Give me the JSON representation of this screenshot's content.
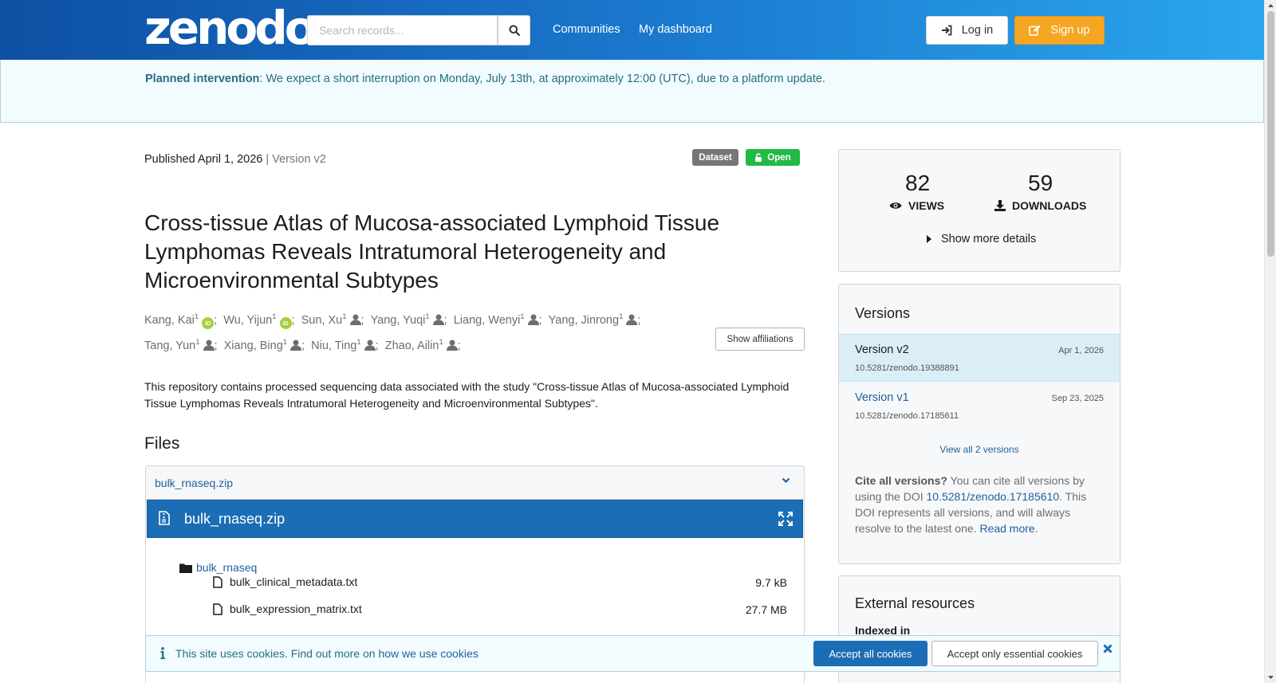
{
  "header": {
    "logo": "zenodo",
    "search_placeholder": "Search records...",
    "nav": [
      "Communities",
      "My dashboard"
    ],
    "login_label": "Log in",
    "signup_label": "Sign up"
  },
  "banner": {
    "label": "Planned intervention",
    "text": ": We expect a short interruption on Monday, July 13th, at approximately 12:00 (UTC), due to a platform update."
  },
  "record": {
    "published": "Published April 1, 2026",
    "separator": " | ",
    "version": "Version v2",
    "badge_type": "Dataset",
    "badge_access": "Open",
    "title": "Cross-tissue Atlas of Mucosa-associated Lymphoid Tissue Lymphomas Reveals Intratumoral Heterogeneity and Microenvironmental Subtypes",
    "creators": [
      {
        "name": "Kang, Kai",
        "aff": "1",
        "icon": "orcid"
      },
      {
        "name": "Wu, Yijun",
        "aff": "1",
        "icon": "orcid"
      },
      {
        "name": "Sun, Xu",
        "aff": "1",
        "icon": "person"
      },
      {
        "name": "Yang, Yuqi",
        "aff": "1",
        "icon": "person"
      },
      {
        "name": "Liang, Wenyi",
        "aff": "1",
        "icon": "person"
      },
      {
        "name": "Yang, Jinrong",
        "aff": "1",
        "icon": "person"
      },
      {
        "name": "Tang, Yun",
        "aff": "1",
        "icon": "person"
      },
      {
        "name": "Xiang, Bing",
        "aff": "1",
        "icon": "person"
      },
      {
        "name": "Niu, Ting",
        "aff": "1",
        "icon": "person"
      },
      {
        "name": "Zhao, Ailin",
        "aff": "1",
        "icon": "person"
      }
    ],
    "show_affiliations": "Show affiliations",
    "description": "This repository contains processed sequencing data associated with the study \"Cross-tissue Atlas of Mucosa-associated Lymphoid Tissue Lymphomas Reveals Intratumoral Heterogeneity and Microenvironmental Subtypes\".",
    "files_heading": "Files",
    "file_accordion": "bulk_rnaseq.zip",
    "preview_name": "bulk_rnaseq.zip",
    "tree_folder": "bulk_rnaseq",
    "tree_files": [
      {
        "name": "bulk_clinical_metadata.txt",
        "size": "9.7 kB"
      },
      {
        "name": "bulk_expression_matrix.txt",
        "size": "27.7 MB"
      }
    ]
  },
  "sidebar": {
    "views_count": "82",
    "views_label": "VIEWS",
    "downloads_count": "59",
    "downloads_label": "DOWNLOADS",
    "show_more": "Show more details",
    "versions_title": "Versions",
    "versions": [
      {
        "name": "Version v2",
        "doi": "10.5281/zenodo.19388891",
        "date": "Apr 1, 2026"
      },
      {
        "name": "Version v1",
        "doi": "10.5281/zenodo.17185611",
        "date": "Sep 23, 2025"
      }
    ],
    "view_all": "View all 2 versions",
    "cite_bold": "Cite all versions?",
    "cite_text1": " You can cite all versions by using the DOI ",
    "cite_doi": "10.5281/zenodo.17185610",
    "cite_text2": ". This DOI represents all versions, and will always resolve to the latest one. ",
    "cite_read_more": "Read more",
    "cite_end": ".",
    "external_title": "External resources",
    "indexed_in": "Indexed in"
  },
  "cookie": {
    "text": "This site uses cookies. Find out more on ",
    "link": "how we use cookies",
    "accept_all": "Accept all cookies",
    "accept_essential": "Accept only essential cookies"
  },
  "colors": {
    "header_start": "#0d4fa3",
    "header_end": "#2aa6ee",
    "signup": "#f5a623",
    "open_badge": "#21ba45",
    "preview_bar": "#1b6eb5",
    "link": "#1f5f9e"
  }
}
